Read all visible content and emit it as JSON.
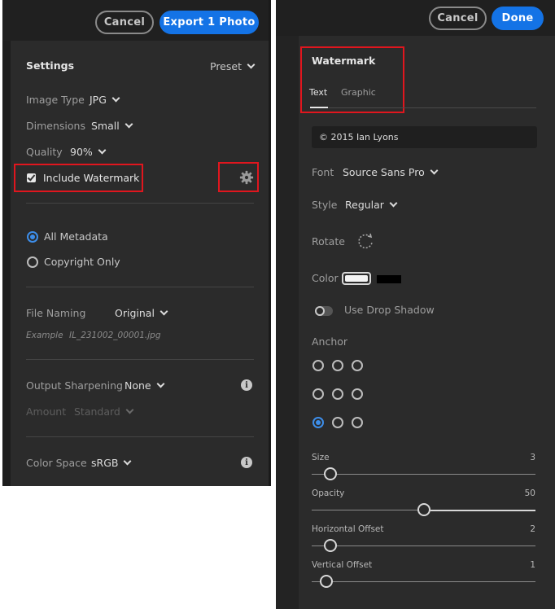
{
  "left": {
    "cancel_label": "Cancel",
    "export_label": "Export 1 Photo",
    "settings_heading": "Settings",
    "preset_label": "Preset",
    "image_type": {
      "label": "Image Type",
      "value": "JPG"
    },
    "dimensions": {
      "label": "Dimensions",
      "value": "Small"
    },
    "quality": {
      "label": "Quality",
      "value": "90%"
    },
    "watermark": {
      "label": "Include Watermark",
      "checked": true
    },
    "metadata_options": [
      {
        "label": "All Metadata",
        "selected": true
      },
      {
        "label": "Copyright Only",
        "selected": false
      }
    ],
    "file_naming": {
      "label": "File Naming",
      "value": "Original"
    },
    "example": {
      "label": "Example",
      "value": "IL_231002_00001.jpg"
    },
    "output_sharpening": {
      "label": "Output Sharpening",
      "value": "None"
    },
    "amount": {
      "label": "Amount",
      "value": "Standard"
    },
    "color_space": {
      "label": "Color Space",
      "value": "sRGB"
    }
  },
  "right": {
    "cancel_label": "Cancel",
    "done_label": "Done",
    "watermark_heading": "Watermark",
    "tabs": [
      {
        "label": "Text",
        "active": true
      },
      {
        "label": "Graphic",
        "active": false
      }
    ],
    "watermark_text": "© 2015 Ian Lyons",
    "font": {
      "label": "Font",
      "value": "Source Sans Pro"
    },
    "style": {
      "label": "Style",
      "value": "Regular"
    },
    "rotate_label": "Rotate",
    "color": {
      "label": "Color",
      "primary": "#f4f4f4",
      "secondary": "#000000"
    },
    "drop_shadow": {
      "label": "Use Drop Shadow",
      "enabled": false
    },
    "anchor": {
      "label": "Anchor",
      "selected_row": 3,
      "selected_col": 1
    },
    "sliders": [
      {
        "label": "Size",
        "value": "3",
        "fraction": 0.05
      },
      {
        "label": "Opacity",
        "value": "50",
        "fraction": 0.5
      },
      {
        "label": "Horizontal Offset",
        "value": "2",
        "fraction": 0.05
      },
      {
        "label": "Vertical Offset",
        "value": "1",
        "fraction": 0.03
      }
    ]
  },
  "colors": {
    "accent": "#1473e6",
    "highlight": "#e0161e",
    "panel": "#2b2b2b"
  }
}
